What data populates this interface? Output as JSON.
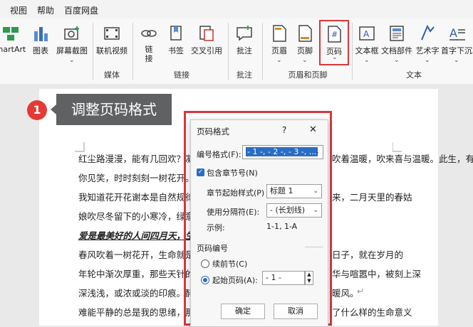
{
  "menu": {
    "items": [
      "视图",
      "帮助",
      "百度网盘"
    ]
  },
  "ribbon": {
    "buttons": {
      "smartart": "martArt",
      "chart": "图表",
      "screenshot": "屏幕截图",
      "online_video": "联机视频",
      "link": "链\n接",
      "bookmark": "书签",
      "cross_ref": "交叉引用",
      "comment": "批注",
      "header": "页眉",
      "footer": "页脚",
      "page_number": "页码",
      "textbox": "文本框",
      "doc_parts": "文档部件",
      "wordart": "艺术字",
      "dropcap": "首字下沉"
    },
    "groups": {
      "media": "媒体",
      "links": "链接",
      "comments": "批注",
      "header_footer": "页眉和页脚",
      "text": "文本"
    },
    "accent": "#d9373b"
  },
  "callout": {
    "step": "1",
    "label": "调整页码格式"
  },
  "document": {
    "lines": [
      "红尘路漫漫，能有几回欢？凝",
      "你见笑，时时刻刻一树花开。",
      "我知道花开花谢本是自然规律",
      "娘吹尽冬留下的小寒冷，绿意",
      "爱是最美好的人间四月天，生",
      "春风吹着一树花开，生命就是一",
      "年轮中渐次厚重，那些天针的",
      "深浅浅，或浓或淡的印痕。醉",
      "难能平静的总是我的思绪，那"
    ],
    "lines_right": [
      "吹着温暖，吹来喜与温暖。此生，有",
      "",
      "来，二月天里的春姑",
      "",
      "",
      "日子，就在岁月的",
      "华与喧嚣中，被刻上深",
      "暖风。",
      "了什么样的生命意义"
    ],
    "right_marks": [
      "↵",
      "",
      "",
      "",
      "",
      "",
      "",
      "↵",
      "↵"
    ]
  },
  "dialog": {
    "title": "页码格式",
    "help": "?",
    "close": "✕",
    "format_label": "编号格式(F):",
    "format_value": "- 1 -, - 2 -, - 3 -, ...",
    "include_chapter": "包含章节号(N)",
    "chapter_style_label": "章节起始样式(P)",
    "chapter_style_value": "标题 1",
    "separator_label": "使用分隔符(E):",
    "separator_value": "- (长划线)",
    "example_label": "示例:",
    "example_value": "1-1, 1-A",
    "numbering_label": "页码编号",
    "continue_label": "续前节(C)",
    "start_at_label": "起始页码(A):",
    "start_at_value": "- 1 -",
    "ok": "确定",
    "cancel": "取消"
  }
}
